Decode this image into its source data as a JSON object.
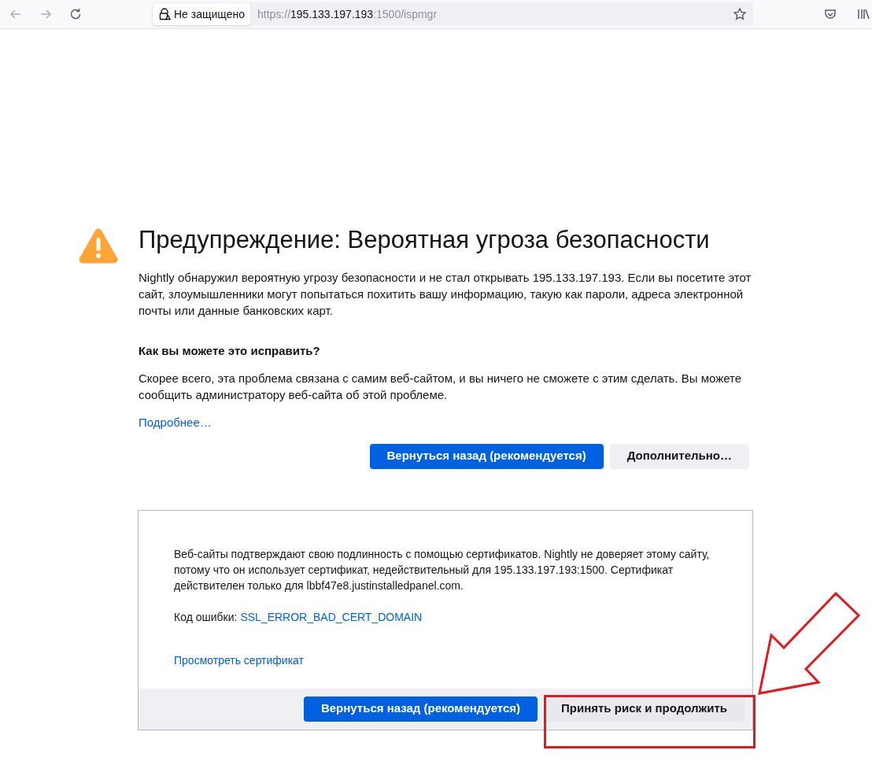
{
  "toolbar": {
    "security_label": "Не защищено",
    "url": {
      "scheme": "https://",
      "host": "195.133.197.193",
      "rest": ":1500/ispmgr"
    }
  },
  "error": {
    "title": "Предупреждение: Вероятная угроза безопасности",
    "intro": "Nightly обнаружил вероятную угрозу безопасности и не стал открывать 195.133.197.193. Если вы посетите этот сайт, злоумышленники могут попытаться похитить вашу информацию, такую как пароли, адреса электронной почты или данные банковских карт.",
    "fix_heading": "Как вы можете это исправить?",
    "fix_text": "Скорее всего, эта проблема связана с самим веб-сайтом, и вы ничего не сможете с этим сделать. Вы можете сообщить администратору веб-сайта об этой проблеме.",
    "learn_more": "Подробнее…",
    "buttons": [
      {
        "label": "Вернуться назад (рекомендуется)",
        "kind": "primary"
      },
      {
        "label": "Дополнительно…",
        "kind": "secondary"
      }
    ]
  },
  "advanced": {
    "text": "Веб-сайты подтверждают свою подлинность с помощью сертификатов. Nightly не доверяет этому сайту, потому что он использует сертификат, недействительный для 195.133.197.193:1500. Сертификат действителен только для lbbf47e8.justinstalledpanel.com.",
    "error_code_label": "Код ошибки:",
    "error_code": "SSL_ERROR_BAD_CERT_DOMAIN",
    "view_certificate": "Просмотреть сертификат",
    "buttons": [
      {
        "label": "Вернуться назад (рекомендуется)",
        "kind": "primary"
      },
      {
        "label": "Принять риск и продолжить",
        "kind": "secondary"
      }
    ]
  }
}
